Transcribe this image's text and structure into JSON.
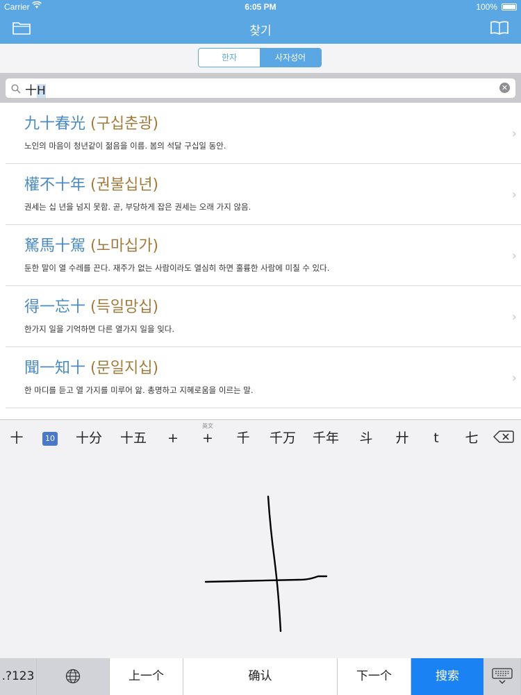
{
  "status": {
    "carrier": "Carrier",
    "time": "6:05 PM",
    "battery": "100%"
  },
  "nav": {
    "title": "찾기"
  },
  "segment": {
    "items": [
      "한자",
      "사자성어"
    ],
    "selected": "사자성어"
  },
  "search": {
    "value_plain": "十",
    "value_marked": "H"
  },
  "results": [
    {
      "hanja": "九十春光",
      "reading": "(구십춘광)",
      "desc": "노인의 마음이 청년같이 젊음을 이름. 봄의 석달 구십일 동안."
    },
    {
      "hanja": "權不十年",
      "reading": "(권불십년)",
      "desc": "권세는 십 년을 넘지 못함. 곧, 부당하게 잡은 권세는 오래 가지 않음."
    },
    {
      "hanja": "駑馬十駕",
      "reading": "(노마십가)",
      "desc": "둔한 말이 열 수레를 끈다. 재주가 없는 사람이라도 열심히 하면 훌륭한 사람에 미칠 수 있다."
    },
    {
      "hanja": "得一忘十",
      "reading": "(득일망십)",
      "desc": "한가지 일을 기억하면 다른 열가지 일을 잊다."
    },
    {
      "hanja": "聞一知十",
      "reading": "(문일지십)",
      "desc": "한 마디를 듣고 열 가지를 미루어 앎. 총명하고 지혜로움을 이르는 말."
    }
  ],
  "keyboard": {
    "candidates": [
      {
        "label": "十",
        "w": 48
      },
      {
        "label": "10",
        "w": 48,
        "emoji": true
      },
      {
        "label": "十分",
        "w": 64
      },
      {
        "label": "十五",
        "w": 64
      },
      {
        "label": "+",
        "w": 50
      },
      {
        "label": "+",
        "w": 50,
        "note": "英文"
      },
      {
        "label": "千",
        "w": 52
      },
      {
        "label": "千万",
        "w": 62
      },
      {
        "label": "千年",
        "w": 62
      },
      {
        "label": "斗",
        "w": 54
      },
      {
        "label": "廾",
        "w": 50
      },
      {
        "label": "t",
        "w": 48
      },
      {
        "label": "七",
        "w": 54
      }
    ],
    "bottom": {
      "symbols": ".?123",
      "prev": "上一个",
      "confirm": "确认",
      "next": "下一个",
      "search": "搜索"
    }
  }
}
